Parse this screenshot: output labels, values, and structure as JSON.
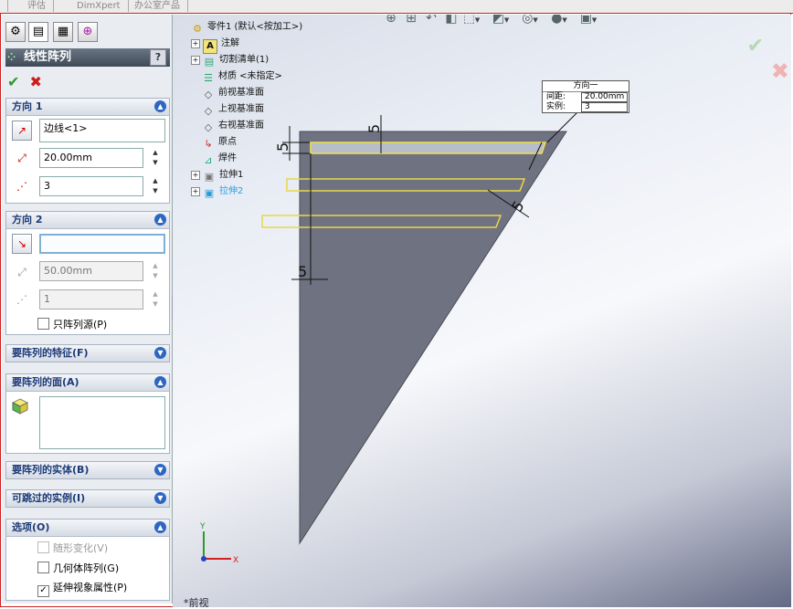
{
  "top_tabs": [
    "评估",
    "DimXpert",
    "办公室产品"
  ],
  "panel": {
    "title": "线性阵列",
    "help": "?",
    "direction1": {
      "header": "方向 1",
      "edge_value": "边线<1>",
      "spacing": "20.00mm",
      "instances": "3"
    },
    "direction2": {
      "header": "方向 2",
      "edge_value": "",
      "spacing": "50.00mm",
      "instances": "1",
      "pattern_seed_only": "只阵列源(P)"
    },
    "features_header": "要阵列的特征(F)",
    "faces_header": "要阵列的面(A)",
    "bodies_header": "要阵列的实体(B)",
    "skip_header": "可跳过的实例(I)",
    "options": {
      "header": "选项(O)",
      "vary_sketch": "随形变化(V)",
      "geometry_pattern": "几何体阵列(G)",
      "propagate_visual": "延伸视象属性(P)",
      "vary_sketch_checked": false,
      "geometry_pattern_checked": false,
      "propagate_visual_checked": true
    }
  },
  "tree": {
    "root": "零件1 (默认<按加工>)",
    "items": [
      {
        "label": "注解",
        "icon": "annotation-icon",
        "expandable": true
      },
      {
        "label": "切割清单(1)",
        "icon": "cut-list-icon",
        "expandable": true
      },
      {
        "label": "材质 <未指定>",
        "icon": "material-icon",
        "expandable": false
      },
      {
        "label": "前视基准面",
        "icon": "plane-icon",
        "expandable": false
      },
      {
        "label": "上视基准面",
        "icon": "plane-icon",
        "expandable": false
      },
      {
        "label": "右视基准面",
        "icon": "plane-icon",
        "expandable": false
      },
      {
        "label": "原点",
        "icon": "origin-icon",
        "expandable": false
      },
      {
        "label": "焊件",
        "icon": "weldment-icon",
        "expandable": false
      },
      {
        "label": "拉伸1",
        "icon": "extrude-icon",
        "expandable": true
      },
      {
        "label": "拉伸2",
        "icon": "extrude-icon",
        "expandable": true,
        "highlight": true
      }
    ]
  },
  "callout": {
    "title": "方向一",
    "spacing_label": "间距:",
    "spacing_value": "20.00mm",
    "instances_label": "实例:",
    "instances_value": "3"
  },
  "dimensions": [
    "5",
    "5",
    "5",
    "5"
  ],
  "axes": {
    "y": "Y",
    "x": "X"
  },
  "view_label": "*前视",
  "colors": {
    "part": "#6f7280",
    "preview": "#e8d84a",
    "accent": "#2d66c3"
  }
}
